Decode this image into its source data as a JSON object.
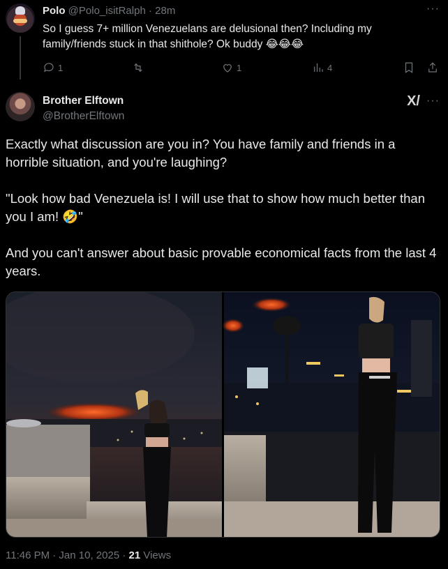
{
  "reply": {
    "display_name": "Polo",
    "handle": "@Polo_isitRalph",
    "separator": "·",
    "time": "28m",
    "text": "So I guess 7+ million Venezuelans are delusional then? Including my family/friends stuck in that shithole? Ok buddy 😂😂😂",
    "replies_count": "1",
    "likes_count": "1",
    "views_count": "4",
    "more_label": "···"
  },
  "post": {
    "display_name": "Brother Elftown",
    "handle": "@BrotherElftown",
    "grok_label": "X/",
    "more_label": "···",
    "paragraphs": [
      "Exactly what discussion are you in? You have family and friends in a horrible situation, and you're laughing?",
      "\"Look how bad Venezuela is! I will use that to show how much better than you I am! 🤣\"",
      "And you can't answer about basic provable economical facts from the last 4 years."
    ],
    "timestamp": "11:46 PM · Jan 10, 2025 · ",
    "views_number": "21",
    "views_label": " Views"
  },
  "colors": {
    "background": "#000000",
    "text": "#e7e9ea",
    "muted": "#71767b",
    "divider": "#333639"
  }
}
